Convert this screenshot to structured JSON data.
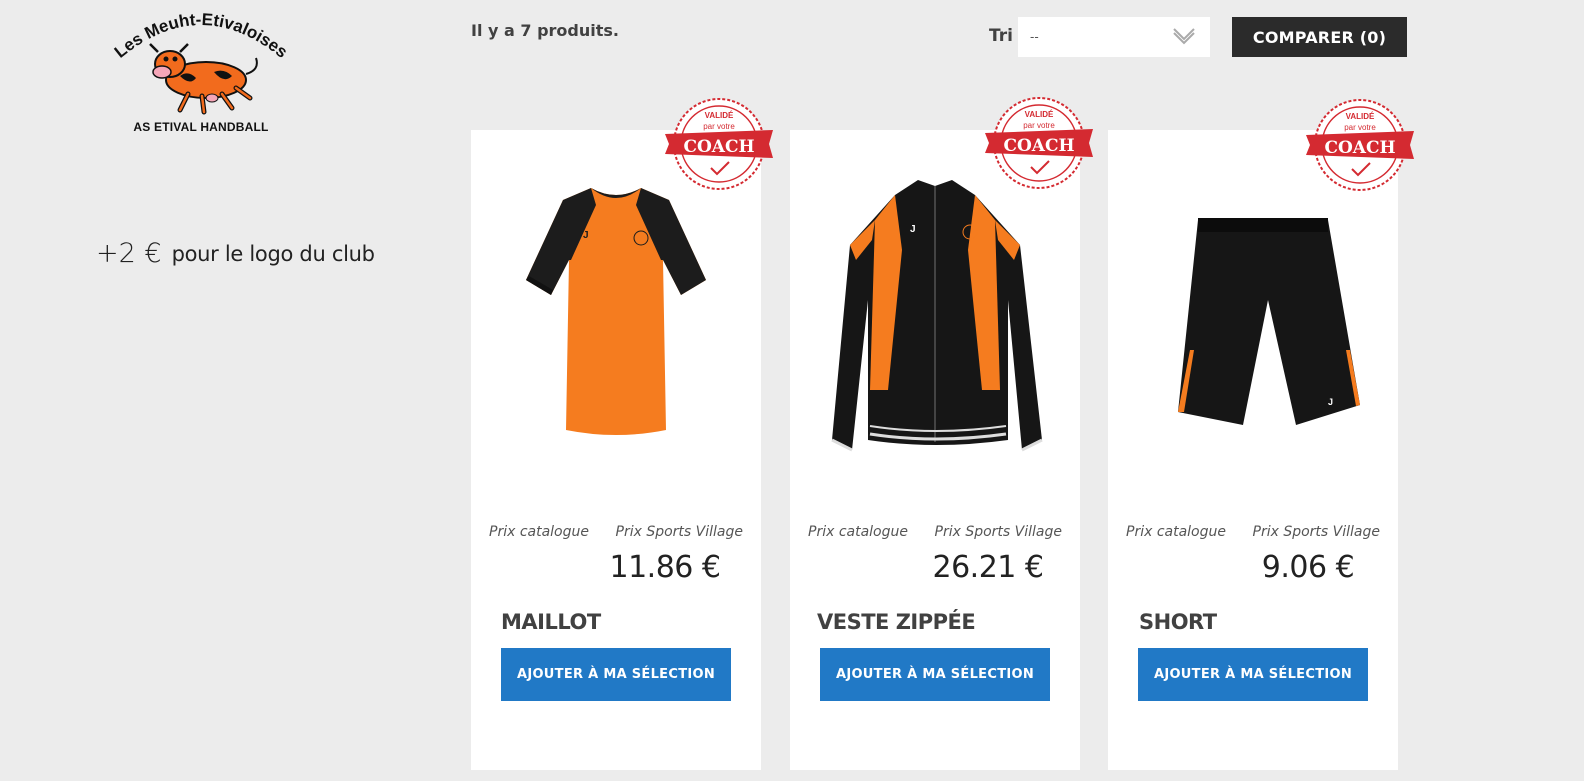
{
  "logo": {
    "arc_text": "Les Meuht-Etivaloises",
    "subtitle": "AS ETIVAL HANDBALL"
  },
  "promo": {
    "amount": "+2 €",
    "text": "pour le logo du club"
  },
  "listing": {
    "count_text": "Il y a 7 produits."
  },
  "sort": {
    "label": "Tri",
    "value": "--"
  },
  "compare": {
    "label": "COMPARER (0)"
  },
  "badge": {
    "top": "VALIDÉ",
    "middle": "par votre",
    "main": "COACH"
  },
  "products": [
    {
      "catalog_label": "Prix catalogue",
      "price_label": "Prix Sports Village",
      "price": "11.86 €",
      "name": "MAILLOT",
      "button": "AJOUTER À MA SÉLECTION"
    },
    {
      "catalog_label": "Prix catalogue",
      "price_label": "Prix Sports Village",
      "price": "26.21 €",
      "name": "VESTE ZIPPÉE",
      "button": "AJOUTER À MA SÉLECTION"
    },
    {
      "catalog_label": "Prix catalogue",
      "price_label": "Prix Sports Village",
      "price": "9.06 €",
      "name": "SHORT",
      "button": "AJOUTER À MA SÉLECTION"
    }
  ],
  "colors": {
    "accent": "#2179c6",
    "dark": "#2b2b2b",
    "orange": "#f57c1f",
    "badge_red": "#d42a31"
  }
}
